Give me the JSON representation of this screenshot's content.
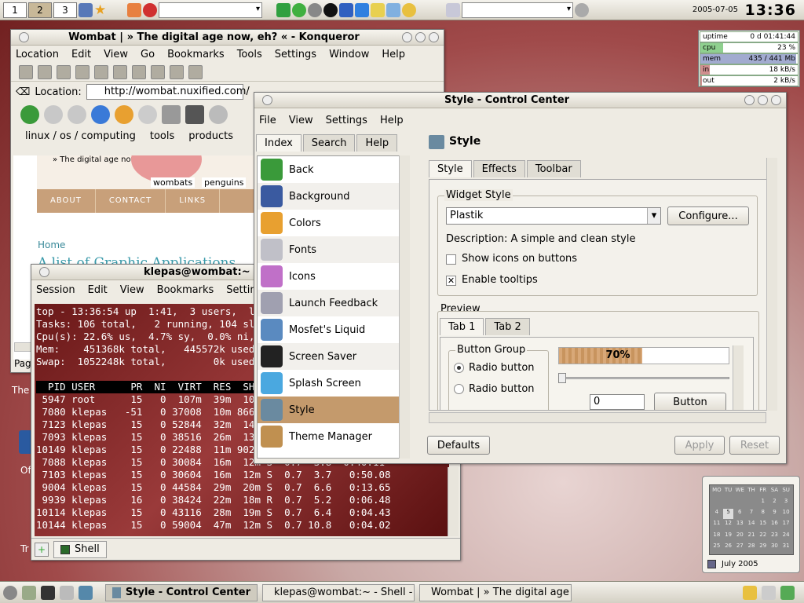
{
  "top_panel": {
    "desktops": [
      "1",
      "2",
      "3"
    ],
    "date": "2005-07-05",
    "time": "13:36"
  },
  "sysmon": [
    {
      "label": "uptime",
      "value": "0 d 01:41:44",
      "level": 0
    },
    {
      "label": "cpu",
      "value": "23 %",
      "level": 0.23
    },
    {
      "label": "mem",
      "value": "435 / 441 Mb",
      "level": 0.98
    },
    {
      "label": "in",
      "value": "18 kB/s",
      "level": 0.1
    },
    {
      "label": "out",
      "value": "2 kB/s",
      "level": 0.02
    }
  ],
  "konqueror": {
    "title": "Wombat | » The digital age now, eh? « - Konqueror",
    "menu": [
      "Location",
      "Edit",
      "View",
      "Go",
      "Bookmarks",
      "Tools",
      "Settings",
      "Window",
      "Help"
    ],
    "location_label": "Location:",
    "url": "http://wombat.nuxified.com/",
    "bookmarks": [
      "linux / os / computing",
      "tools",
      "products"
    ],
    "page": {
      "tagline": "» The digital age now, eh? «",
      "tags": [
        "wombats",
        "penguins"
      ],
      "nav": [
        "ABOUT",
        "CONTACT",
        "LINKS"
      ],
      "home_link": "Home",
      "heading": "A list of Graphic Applications",
      "side_texts": [
        "Pag",
        "The",
        "Of",
        "Tr"
      ]
    }
  },
  "terminal": {
    "title": "klepas@wombat:~ - Shell - Konsole",
    "menu": [
      "Session",
      "Edit",
      "View",
      "Bookmarks",
      "Settings"
    ],
    "lines": [
      "top - 13:36:54 up  1:41,  3 users,  load average: 0.18",
      "Tasks: 106 total,   2 running, 104 sleeping,   0 stopped",
      "Cpu(s): 22.6% us,  4.7% sy,  0.0% ni, 72.4% id,  0.0% wa",
      "Mem:    451368k total,   445572k used,     5796k free",
      "Swap:  1052248k total,        0k used,  1052248k free",
      "",
      "  PID USER      PR  NI  VIRT  RES  SHR S %CPU %MEM    TIME+",
      " 5947 root      15   0  107m  39m  10m S  9.8  8.9  4:02.31",
      " 7080 klepas   -51   0 37008  10m 8660 S  4.9  2.4  1:12.05",
      " 7123 klepas    15   0 52844  32m  14m S  2.9  7.4  0:31.22",
      " 7093 klepas    15   0 38516  26m  13m S  1.0  5.9  0:12.77",
      "10149 klepas    15   0 22488  11m 9024 S  1.0  2.6  0:01.45",
      " 7088 klepas    15   0 30084  16m  12m S  0.7  3.8  0:40.11",
      " 7103 klepas    15   0 30604  16m  12m S  0.7  3.7   0:50.08",
      " 9004 klepas    15   0 44584  29m  20m S  0.7  6.6   0:13.65",
      " 9939 klepas    16   0 38424  22m  18m R  0.7  5.2   0:06.48",
      "10114 klepas    15   0 43116  28m  19m S  0.7  6.4   0:04.43",
      "10144 klepas    15   0 59004  47m  12m S  0.7 10.8   0:04.02"
    ],
    "tab_label": "Shell"
  },
  "control_center": {
    "title": "Style - Control Center",
    "menu": [
      "File",
      "View",
      "Settings",
      "Help"
    ],
    "side_tabs": [
      "Index",
      "Search",
      "Help"
    ],
    "items": [
      "Back",
      "Background",
      "Colors",
      "Fonts",
      "Icons",
      "Launch Feedback",
      "Mosfet's Liquid",
      "Screen Saver",
      "Splash Screen",
      "Style",
      "Theme Manager"
    ],
    "selected_item": "Style",
    "module_title": "Style",
    "tabs": [
      "Style",
      "Effects",
      "Toolbar"
    ],
    "widget_style_label": "Widget Style",
    "widget_style_value": "Plastik",
    "configure_label": "Configure...",
    "description": "Description: A simple and clean style",
    "show_icons_label": "Show icons on buttons",
    "show_icons_checked": false,
    "tooltips_label": "Enable tooltips",
    "tooltips_checked": true,
    "preview_label": "Preview",
    "preview_tabs": [
      "Tab 1",
      "Tab 2"
    ],
    "button_group_label": "Button Group",
    "radio1": "Radio button",
    "radio2": "Radio button",
    "progress_text": "70%",
    "progress": 0.7,
    "spin_value": "0",
    "button_label": "Button",
    "defaults_label": "Defaults",
    "apply_label": "Apply",
    "reset_label": "Reset"
  },
  "calendar": {
    "weekdays": [
      "MO",
      "TU",
      "WE",
      "TH",
      "FR",
      "SA",
      "SU"
    ],
    "days": [
      "",
      "",
      "",
      "",
      "1",
      "2",
      "3",
      "4",
      "5",
      "6",
      "7",
      "8",
      "9",
      "10",
      "11",
      "12",
      "13",
      "14",
      "15",
      "16",
      "17",
      "18",
      "19",
      "20",
      "21",
      "22",
      "23",
      "24",
      "25",
      "26",
      "27",
      "28",
      "29",
      "30",
      "31"
    ],
    "month": "July 2005"
  },
  "taskbar": {
    "tasks": [
      "Style - Control Center",
      "klepas@wombat:~ - Shell - Konsole",
      "Wombat | » The digital age now, eh? « - Konqueror"
    ]
  }
}
